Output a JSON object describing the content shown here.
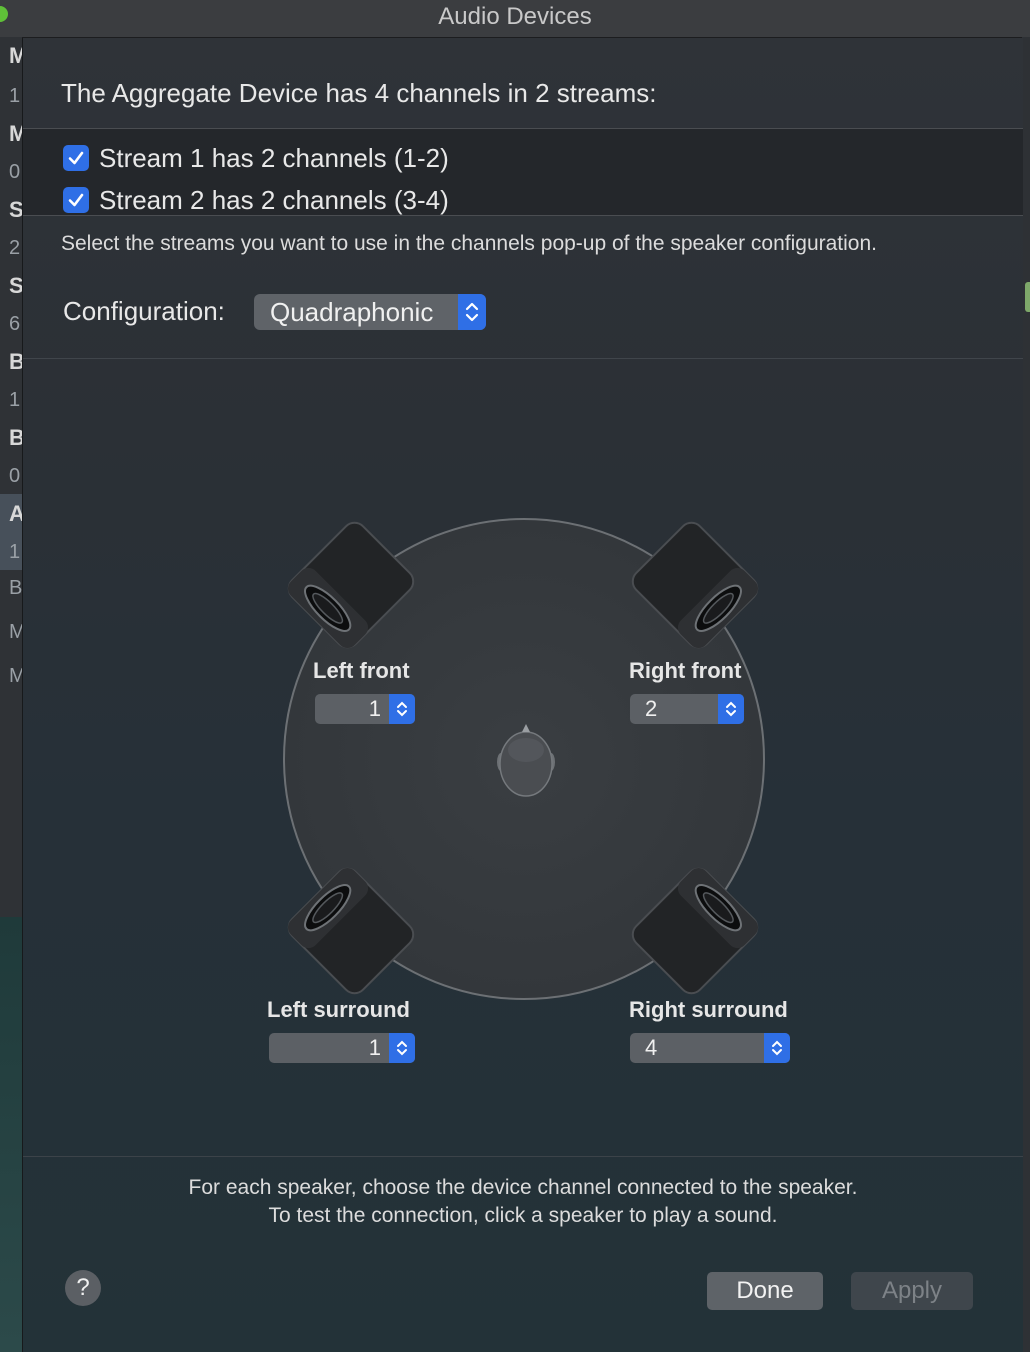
{
  "window": {
    "title": "Audio Devices"
  },
  "background_sidebar": {
    "letters": [
      "M",
      "1",
      "M",
      "0",
      "S",
      "2",
      "S",
      "6",
      "B",
      "1",
      "B",
      "0",
      "A",
      "1",
      "B",
      "M",
      "M"
    ]
  },
  "header": {
    "text": "The Aggregate Device has 4 channels in 2 streams:"
  },
  "streams": [
    {
      "label": "Stream 1 has 2 channels (1-2)",
      "checked": true
    },
    {
      "label": "Stream 2 has 2 channels (3-4)",
      "checked": true
    }
  ],
  "hint": "Select the streams you want to use in the channels pop-up of the speaker configuration.",
  "configuration": {
    "label": "Configuration:",
    "value": "Quadraphonic"
  },
  "speakers": {
    "left_front": {
      "label": "Left front",
      "channel": "1"
    },
    "right_front": {
      "label": "Right front",
      "channel": "2"
    },
    "left_surround": {
      "label": "Left surround",
      "channel": "1"
    },
    "right_surround": {
      "label": "Right surround",
      "channel": "4"
    }
  },
  "footer": {
    "line1": "For each speaker, choose the device channel connected to the speaker.",
    "line2": "To test the connection, click a speaker to play a sound."
  },
  "buttons": {
    "help": "?",
    "done": "Done",
    "apply": "Apply"
  },
  "colors": {
    "accent": "#2f6fe6",
    "sheet_bg": "#2b3036",
    "traffic_green": "#5fc038"
  },
  "icons": {
    "checkbox": "checkmark-icon",
    "stepper": "chevron-updown-icon",
    "speaker": "speaker-icon",
    "listener": "listener-head-icon"
  }
}
